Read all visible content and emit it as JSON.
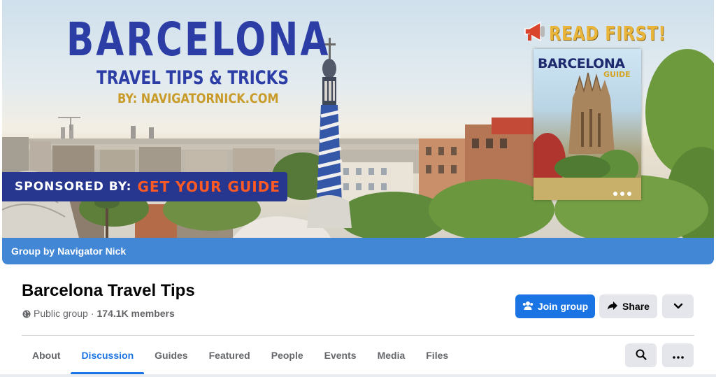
{
  "cover": {
    "title": "BARCELONA",
    "subtitle": "TRAVEL TIPS & TRICKS",
    "byline": "BY: NAVIGATORNICK.COM",
    "sponsor_prefix": "SPONSORED BY:",
    "sponsor_name": "GET YOUR GUIDE",
    "read_first": "READ FIRST!",
    "guide_title": "BARCELONA",
    "guide_subtitle": "GUIDE",
    "group_by": "Group by Navigator Nick",
    "icons": {
      "read_first": "megaphone-icon"
    }
  },
  "header": {
    "title": "Barcelona Travel Tips",
    "privacy": "Public group",
    "separator": "·",
    "members": "174.1K members"
  },
  "actions": {
    "join_label": "Join group",
    "share_label": "Share",
    "icons": {
      "join": "people-icon",
      "share": "share-arrow-icon",
      "more": "chevron-down-icon"
    }
  },
  "tabs": [
    {
      "label": "About",
      "active": false
    },
    {
      "label": "Discussion",
      "active": true
    },
    {
      "label": "Guides",
      "active": false
    },
    {
      "label": "Featured",
      "active": false
    },
    {
      "label": "People",
      "active": false
    },
    {
      "label": "Events",
      "active": false
    },
    {
      "label": "Media",
      "active": false
    },
    {
      "label": "Files",
      "active": false
    }
  ],
  "tab_actions": {
    "icons": {
      "search": "search-icon",
      "more": "more-horizontal-icon"
    }
  },
  "colors": {
    "accent": "#1b74e4",
    "group_bar": "#4287d6",
    "cover_title": "#2c3da6",
    "sponsor_banner": "#27368e",
    "sponsor_name": "#ff5a24",
    "read_first": "#e9b43a",
    "secondary_button": "#e4e6eb",
    "muted_text": "#65676b"
  }
}
